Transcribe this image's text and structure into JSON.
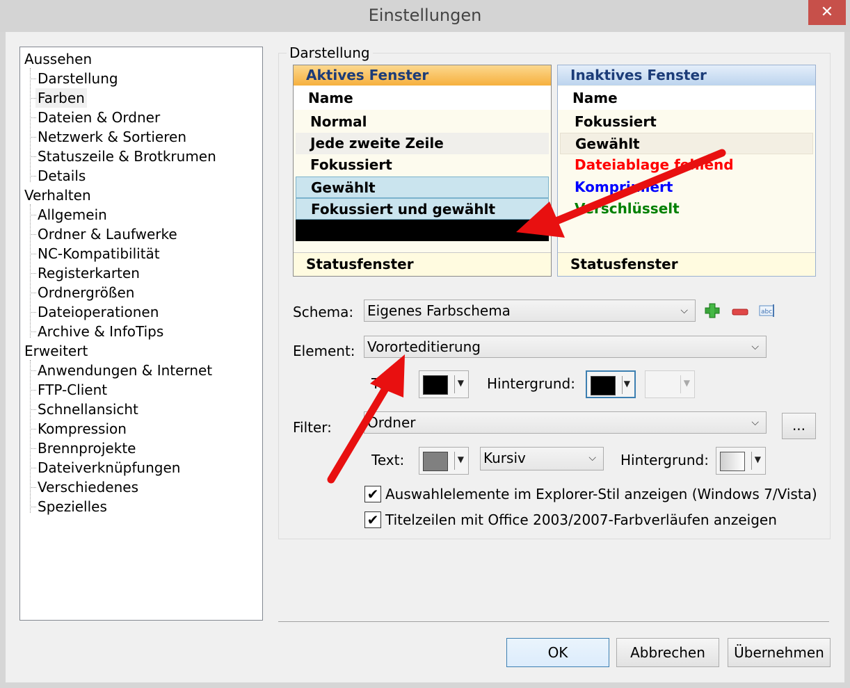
{
  "window": {
    "title": "Einstellungen",
    "close_label": "✕"
  },
  "tree": {
    "items": [
      {
        "label": "Aussehen",
        "level": 0
      },
      {
        "label": "Darstellung",
        "level": 1
      },
      {
        "label": "Farben",
        "level": 1,
        "selected": true
      },
      {
        "label": "Dateien & Ordner",
        "level": 1
      },
      {
        "label": "Netzwerk & Sortieren",
        "level": 1
      },
      {
        "label": "Statuszeile & Brotkrumen",
        "level": 1
      },
      {
        "label": "Details",
        "level": 1
      },
      {
        "label": "Verhalten",
        "level": 0
      },
      {
        "label": "Allgemein",
        "level": 1
      },
      {
        "label": "Ordner & Laufwerke",
        "level": 1
      },
      {
        "label": "NC-Kompatibilität",
        "level": 1
      },
      {
        "label": "Registerkarten",
        "level": 1
      },
      {
        "label": "Ordnergrößen",
        "level": 1
      },
      {
        "label": "Dateioperationen",
        "level": 1
      },
      {
        "label": "Archive & InfoTips",
        "level": 1
      },
      {
        "label": "Erweitert",
        "level": 0
      },
      {
        "label": "Anwendungen & Internet",
        "level": 1
      },
      {
        "label": "FTP-Client",
        "level": 1
      },
      {
        "label": "Schnellansicht",
        "level": 1
      },
      {
        "label": "Kompression",
        "level": 1
      },
      {
        "label": "Brennprojekte",
        "level": 1
      },
      {
        "label": "Dateiverknüpfungen",
        "level": 1
      },
      {
        "label": "Verschiedenes",
        "level": 1
      },
      {
        "label": "Spezielles",
        "level": 1
      }
    ]
  },
  "group": {
    "label": "Darstellung"
  },
  "active_pane": {
    "header": "Aktives Fenster",
    "name_header": "Name",
    "rows": [
      "Normal",
      "Jede zweite Zeile",
      "Fokussiert",
      "Gewählt",
      "Fokussiert und gewählt"
    ],
    "footer": "Statusfenster"
  },
  "inactive_pane": {
    "header": "Inaktives Fenster",
    "name_header": "Name",
    "rows": [
      {
        "label": "Fokussiert",
        "color": "#000000"
      },
      {
        "label": "Gewählt",
        "color": "#000000"
      },
      {
        "label": "Dateiablage fehlend",
        "color": "#ff0000"
      },
      {
        "label": "Komprimiert",
        "color": "#0000ff"
      },
      {
        "label": "Verschlüsselt",
        "color": "#008000"
      }
    ],
    "footer": "Statusfenster"
  },
  "schema": {
    "label": "Schema:",
    "value": "Eigenes Farbschema"
  },
  "element": {
    "label": "Element:",
    "value": "Vororteditierung",
    "text_label": "Text:",
    "bg_label": "Hintergrund:"
  },
  "filter": {
    "label": "Filter:",
    "value": "Ordner",
    "more_label": "...",
    "text_label": "Text:",
    "style_value": "Kursiv",
    "bg_label": "Hintergrund:"
  },
  "checkboxes": [
    {
      "label": "Auswahlelemente im Explorer-Stil anzeigen (Windows 7/Vista)",
      "checked": true
    },
    {
      "label": "Titelzeilen mit Office 2003/2007-Farbverläufen anzeigen",
      "checked": true
    }
  ],
  "buttons": {
    "ok": "OK",
    "cancel": "Abbrechen",
    "apply": "Übernehmen"
  },
  "colors": {
    "arrow": "#e81010",
    "title_bg": "#d4d4d4",
    "close_bg": "#c7504a"
  }
}
